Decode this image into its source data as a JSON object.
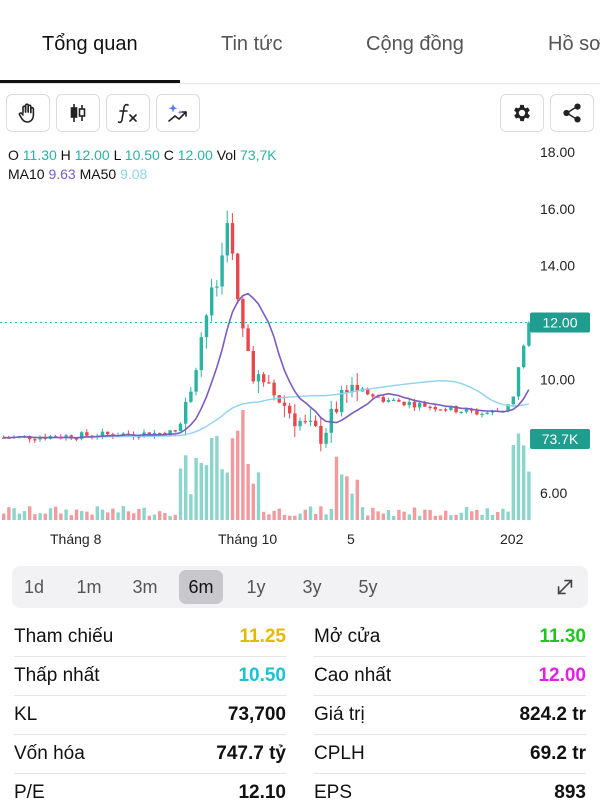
{
  "tabs": [
    "Tổng quan",
    "Tin tức",
    "Cộng đồng",
    "Hồ sơ"
  ],
  "toolbar": {
    "left_icons": [
      "hand-icon",
      "candlestick-icon",
      "function-icon",
      "sparkle-trend-icon"
    ],
    "right_icons": [
      "gear-icon",
      "share-icon"
    ]
  },
  "legend": {
    "o_label": "O",
    "o_value": "11.30",
    "h_label": "H",
    "h_value": "12.00",
    "l_label": "L",
    "l_value": "10.50",
    "c_label": "C",
    "c_value": "12.00",
    "vol_label": "Vol",
    "vol_value": "73,7K",
    "ma10_label": "MA10",
    "ma10_value": "9.63",
    "ma50_label": "MA50",
    "ma50_value": "9.08"
  },
  "chart_data": {
    "type": "candlestick",
    "y_axis_ticks": [
      "18.00",
      "16.00",
      "14.00",
      "12.00",
      "10.00",
      "6.00"
    ],
    "ylim": [
      5.0,
      18.0
    ],
    "x_axis_ticks": [
      "Tháng 8",
      "Tháng 10",
      "5",
      "202"
    ],
    "price_marker": "12.00",
    "volume_marker": "73.7K",
    "last_close": 12.0,
    "ma10_last": 9.63,
    "ma50_last": 9.08
  },
  "ranges": {
    "items": [
      "1d",
      "1m",
      "3m",
      "6m",
      "1y",
      "3y",
      "5y"
    ],
    "selected": "6m"
  },
  "stats": {
    "rows": [
      {
        "l1": "Tham chiếu",
        "v1": "11.25",
        "l2": "Mở cửa",
        "v2": "11.30"
      },
      {
        "l1": "Thấp nhất",
        "v1": "10.50",
        "l2": "Cao nhất",
        "v2": "12.00"
      },
      {
        "l1": "KL",
        "v1": "73,700",
        "l2": "Giá trị",
        "v2": "824.2 tr"
      },
      {
        "l1": "Vốn hóa",
        "v1": "747.7 tỷ",
        "l2": "CPLH",
        "v2": "69.2 tr"
      },
      {
        "l1": "P/E",
        "v1": "12.10",
        "l2": "EPS",
        "v2": "893"
      }
    ]
  },
  "colors": {
    "up": "#2bb3a3",
    "down": "#e8474c",
    "ref_yellow": "#e6b800",
    "open_green": "#1ec71e",
    "low_cyan": "#19c3d6",
    "high_magenta": "#e61ee6",
    "ma10": "#7a5cc4",
    "ma50": "#8fd3ef"
  }
}
